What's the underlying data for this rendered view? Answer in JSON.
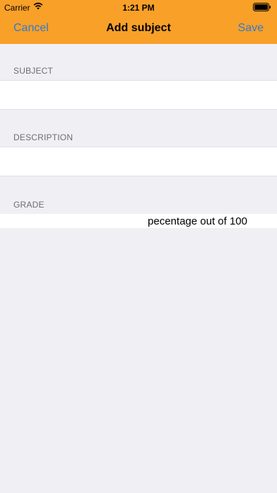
{
  "status_bar": {
    "carrier": "Carrier",
    "time": "1:21 PM"
  },
  "nav": {
    "cancel_label": "Cancel",
    "title": "Add subject",
    "save_label": "Save"
  },
  "form": {
    "subject": {
      "label": "SUBJECT",
      "value": "",
      "placeholder": ""
    },
    "description": {
      "label": "DESCRIPTION",
      "value": "",
      "placeholder": ""
    },
    "grade": {
      "label": "GRADE",
      "value": "",
      "placeholder": "pecentage out of 100"
    }
  },
  "colors": {
    "nav_background": "#f9a029",
    "accent": "#2f7ad1",
    "background": "#efeff4"
  },
  "icons": [
    "wifi-icon",
    "battery-icon"
  ]
}
